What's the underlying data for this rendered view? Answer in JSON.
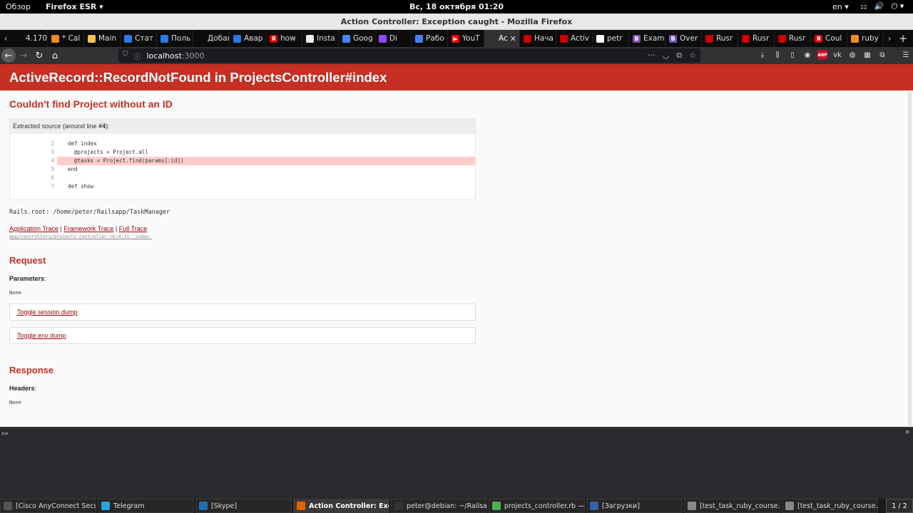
{
  "topbar": {
    "overview": "Обзор",
    "app_menu": "Firefox ESR ▾",
    "clock": "Вс, 18 октября  01:20",
    "lang": "en ▾",
    "tray": [
      "⚏",
      "🔊",
      "⏻ ▾"
    ]
  },
  "window": {
    "title": "Action Controller: Exception caught - Mozilla Firefox"
  },
  "tabs": [
    {
      "label": "4.170.1",
      "icon": "",
      "color": "#0c0c0d",
      "active": false
    },
    {
      "label": "* Cal",
      "icon": "",
      "color": "#f08a24",
      "active": false
    },
    {
      "label": "Main",
      "icon": "",
      "color": "#f5c451",
      "active": false
    },
    {
      "label": "Стат",
      "icon": "",
      "color": "#2a7ae2",
      "active": false
    },
    {
      "label": "Поль",
      "icon": "",
      "color": "#2a7ae2",
      "active": false
    },
    {
      "label": "Добави",
      "icon": "",
      "color": "#0c0c0d",
      "active": false
    },
    {
      "label": "Авар",
      "icon": "",
      "color": "#2a7ae2",
      "active": false
    },
    {
      "label": "how",
      "icon": "Я",
      "color": "#d00",
      "active": false
    },
    {
      "label": "Insta",
      "icon": "",
      "color": "#eee",
      "active": false
    },
    {
      "label": "Goog",
      "icon": "",
      "color": "#4285f4",
      "active": false
    },
    {
      "label": "Di",
      "icon": "",
      "color": "#9146ff",
      "active": false
    },
    {
      "label": "Рабо",
      "icon": "",
      "color": "#4285f4",
      "active": false
    },
    {
      "label": "YouT",
      "icon": "▶",
      "color": "#f00",
      "active": false
    },
    {
      "label": "Actio",
      "icon": "",
      "color": "#323234",
      "active": true
    },
    {
      "label": "Нача",
      "icon": "",
      "color": "#c00",
      "active": false
    },
    {
      "label": "Activ",
      "icon": "",
      "color": "#c00",
      "active": false
    },
    {
      "label": "petr",
      "icon": "",
      "color": "#fff",
      "active": false
    },
    {
      "label": "Exam",
      "icon": "B",
      "color": "#7952b3",
      "active": false
    },
    {
      "label": "Over",
      "icon": "B",
      "color": "#7952b3",
      "active": false
    },
    {
      "label": "Rusr",
      "icon": "",
      "color": "#c00",
      "active": false
    },
    {
      "label": "Rusr",
      "icon": "",
      "color": "#c00",
      "active": false
    },
    {
      "label": "Rusr",
      "icon": "",
      "color": "#c00",
      "active": false
    },
    {
      "label": "Coul",
      "icon": "Я",
      "color": "#d00",
      "active": false
    },
    {
      "label": "ruby",
      "icon": "",
      "color": "#f08a24",
      "active": false
    }
  ],
  "navbar": {
    "url_host": "localhost",
    "url_port": ":3000"
  },
  "page": {
    "header": "ActiveRecord::RecordNotFound in ProjectsController#index",
    "error_message": "Couldn't find Project without an ID",
    "source_head_prefix": "Extracted source (around line ",
    "source_head_line": "#4",
    "source_head_suffix": "):",
    "source_lines": [
      {
        "num": "2",
        "code": "def index",
        "highlight": false
      },
      {
        "num": "3",
        "code": "  @projects = Project.all",
        "highlight": false
      },
      {
        "num": "4",
        "code": "  @tasks = Project.find(params[:id])",
        "highlight": true
      },
      {
        "num": "5",
        "code": "end",
        "highlight": false
      },
      {
        "num": "6",
        "code": "",
        "highlight": false
      },
      {
        "num": "7",
        "code": "def show",
        "highlight": false
      }
    ],
    "rails_root": "Rails.root: /home/peter/Railsapp/TaskManager",
    "trace": {
      "application": "Application Trace",
      "framework": "Framework Trace",
      "full": "Full Trace",
      "sep": " | ",
      "path": "app/controllers/projects_controller.rb:4:in `index'"
    },
    "request": {
      "title": "Request",
      "parameters_label": "Parameters",
      "parameters_value": "None",
      "toggle_session": "Toggle session dump",
      "toggle_env": "Toggle env dump"
    },
    "response": {
      "title": "Response",
      "headers_label": "Headers",
      "headers_value": "None"
    }
  },
  "console": {
    "prompt": ">>",
    "close": "×"
  },
  "taskbar": {
    "items": [
      {
        "label": "[Cisco AnyConnect Secu...",
        "color": "#555",
        "active": false
      },
      {
        "label": "Telegram",
        "color": "#2aa3e0",
        "active": false
      },
      {
        "label": "[Skype]",
        "color": "#1a6fb0",
        "active": false
      },
      {
        "label": "Action Controller: Excep...",
        "color": "#e66000",
        "active": true
      },
      {
        "label": "peter@debian: ~/Railsap...",
        "color": "#333",
        "active": false
      },
      {
        "label": "projects_controller.rb —...",
        "color": "#4caf50",
        "active": false
      },
      {
        "label": "[Загрузки]",
        "color": "#3465a4",
        "active": false
      },
      {
        "label": "[test_task_ruby_course...",
        "color": "#888",
        "active": false
      },
      {
        "label": "[test_task_ruby_course...",
        "color": "#888",
        "active": false
      }
    ],
    "pager": "1 / 2"
  }
}
